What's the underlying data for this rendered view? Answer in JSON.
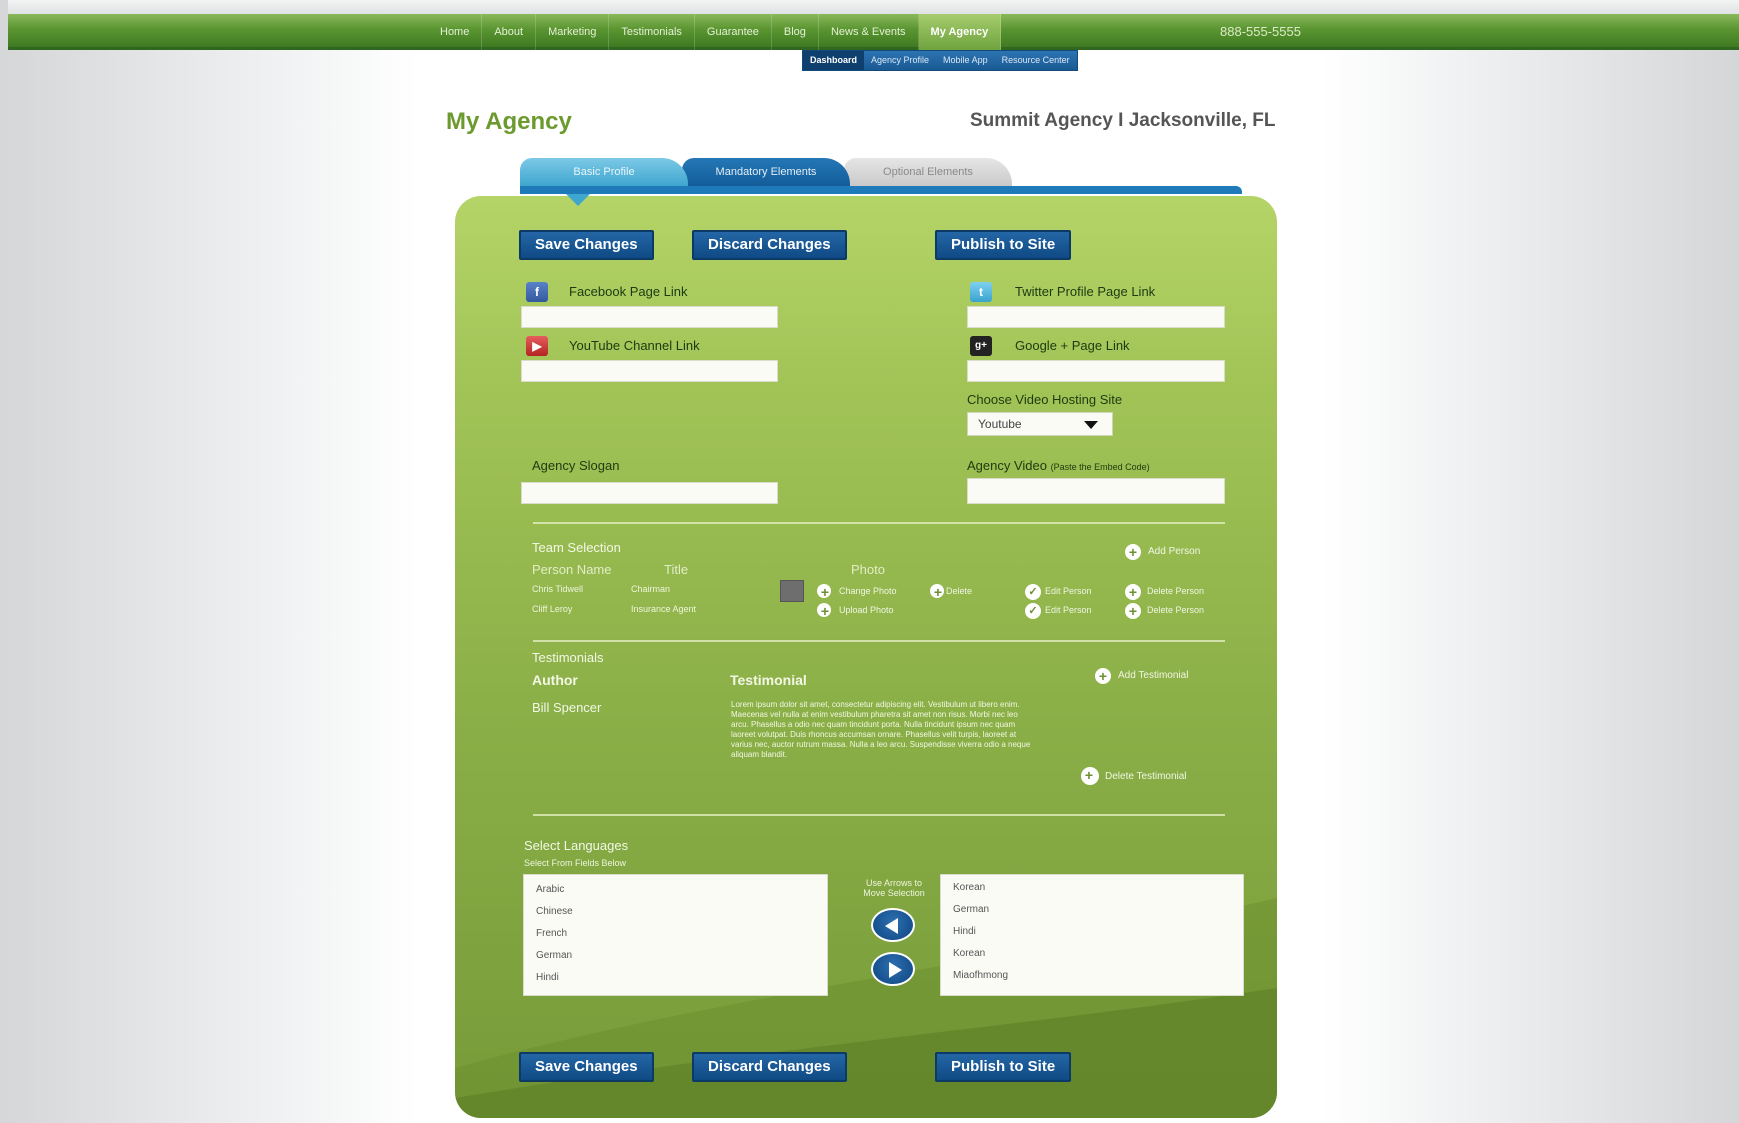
{
  "nav": {
    "items": [
      "Home",
      "About",
      "Marketing",
      "Testimonials",
      "Guarantee",
      "Blog",
      "News & Events",
      "My Agency"
    ],
    "active": "My Agency",
    "phone": "888-555-5555"
  },
  "subnav": {
    "items": [
      "Dashboard",
      "Agency Profile",
      "Mobile App",
      "Resource Center"
    ],
    "active": "Dashboard"
  },
  "header": {
    "title": "My Agency",
    "agency": "Summit Agency I Jacksonville, FL"
  },
  "tabs": {
    "basic": "Basic Profile",
    "mandatory": "Mandatory Elements",
    "optional": "Optional Elements"
  },
  "toolbar": {
    "save": "Save Changes",
    "discard": "Discard Changes",
    "publish": "Publish to Site"
  },
  "social": {
    "facebook": "Facebook Page Link",
    "twitter": "Twitter Profile Page Link",
    "youtube": "YouTube Channel Link",
    "google": "Google + Page Link",
    "facebook_icon": "f",
    "twitter_icon": "t",
    "youtube_icon": "▶",
    "google_icon": "g+"
  },
  "video": {
    "host_label": "Choose Video Hosting Site",
    "host_value": "Youtube",
    "video_label": "Agency Video",
    "video_hint": "(Paste the Embed Code)"
  },
  "slogan": {
    "label": "Agency Slogan"
  },
  "team": {
    "heading": "Team Selection",
    "add": "Add Person",
    "col_name": "Person Name",
    "col_title": "Title",
    "col_photo": "Photo",
    "change_photo": "Change Photo",
    "delete": "Delete",
    "upload_photo": "Upload Photo",
    "edit_person": "Edit Person",
    "delete_person": "Delete Person",
    "rows": [
      {
        "name": "Chris Tidwell",
        "title": "Chairman"
      },
      {
        "name": "Cliff Leroy",
        "title": "Insurance Agent"
      }
    ]
  },
  "testimonials": {
    "heading": "Testimonials",
    "col_author": "Author",
    "col_testimonial": "Testimonial",
    "add": "Add Testimonial",
    "delete": "Delete Testimonial",
    "author": "Bill Spencer",
    "text": "Lorem ipsum dolor sit amet, consectetur adipiscing elit. Vestibulum ut libero enim. Maecenas vel nulla at enim vestibulum pharetra sit amet non risus. Morbi nec leo arcu. Phasellus a odio nec quam tincidunt porta. Nulla tincidunt ipsum nec quam laoreet volutpat. Duis rhoncus accumsan ornare. Phasellus velit turpis, laoreet at varius nec, auctor rutrum massa. Nulla a leo arcu. Suspendisse viverra odio a neque aliquam blandit."
  },
  "languages": {
    "heading": "Select Languages",
    "sub": "Select From Fields Below",
    "hint_line1": "Use Arrows to",
    "hint_line2": "Move Selection",
    "available": [
      "Arabic",
      "Chinese",
      "French",
      "German",
      "Hindi"
    ],
    "selected": [
      "Korean",
      "German",
      "Hindi",
      "Korean",
      "Miaofhmong"
    ]
  }
}
